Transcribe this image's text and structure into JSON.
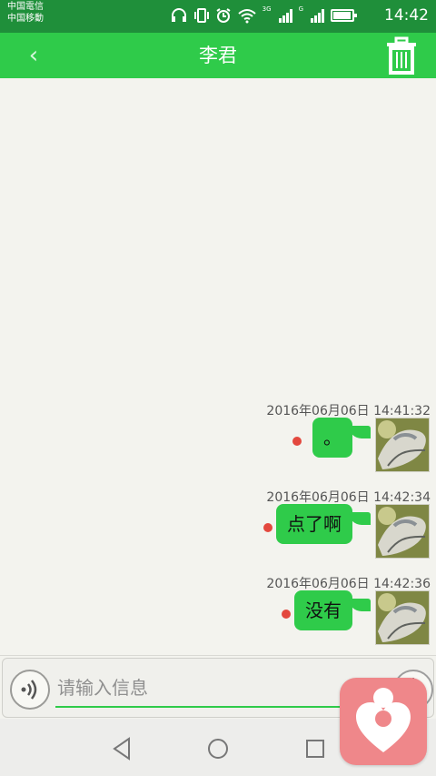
{
  "status_bar": {
    "carrier_1": "中国電信",
    "carrier_2": "中国移動",
    "network_3g": "3G",
    "network_g": "G",
    "time": "14:42",
    "battery_level": 0.85,
    "icons": [
      "headphones-icon",
      "vibrate-icon",
      "alarm-icon",
      "wifi-icon",
      "signal-3g-icon",
      "signal-g-icon",
      "battery-icon"
    ]
  },
  "header": {
    "back_icon": "chevron-left-icon",
    "title": "李君",
    "trash_icon": "trash-icon"
  },
  "messages": [
    {
      "timestamp": "2016年06月06日 14:41:32",
      "text": "。",
      "sender": "self",
      "status": "unread-dot"
    },
    {
      "timestamp": "2016年06月06日 14:42:34",
      "text": "点了啊",
      "sender": "self",
      "status": "unread-dot"
    },
    {
      "timestamp": "2016年06月06日 14:42:36",
      "text": "没有",
      "sender": "self",
      "status": "unread-dot"
    }
  ],
  "input_bar": {
    "placeholder": "请输入信息",
    "voice_icon": "voice-wave-icon",
    "emoji_icon": "emoji-icon",
    "plus_icon": "plus-icon"
  },
  "nav_bar": {
    "back_icon": "triangle-back-icon",
    "home_icon": "circle-home-icon",
    "recents_icon": "square-recents-icon"
  },
  "floating_app": {
    "icon": "heart-person-app-icon"
  },
  "colors": {
    "status_green": "#1f8f3a",
    "accent_green": "#2fcb4a",
    "background": "#f3f3ee",
    "unread_red": "#e3483e",
    "app_pink": "#ef878a"
  }
}
